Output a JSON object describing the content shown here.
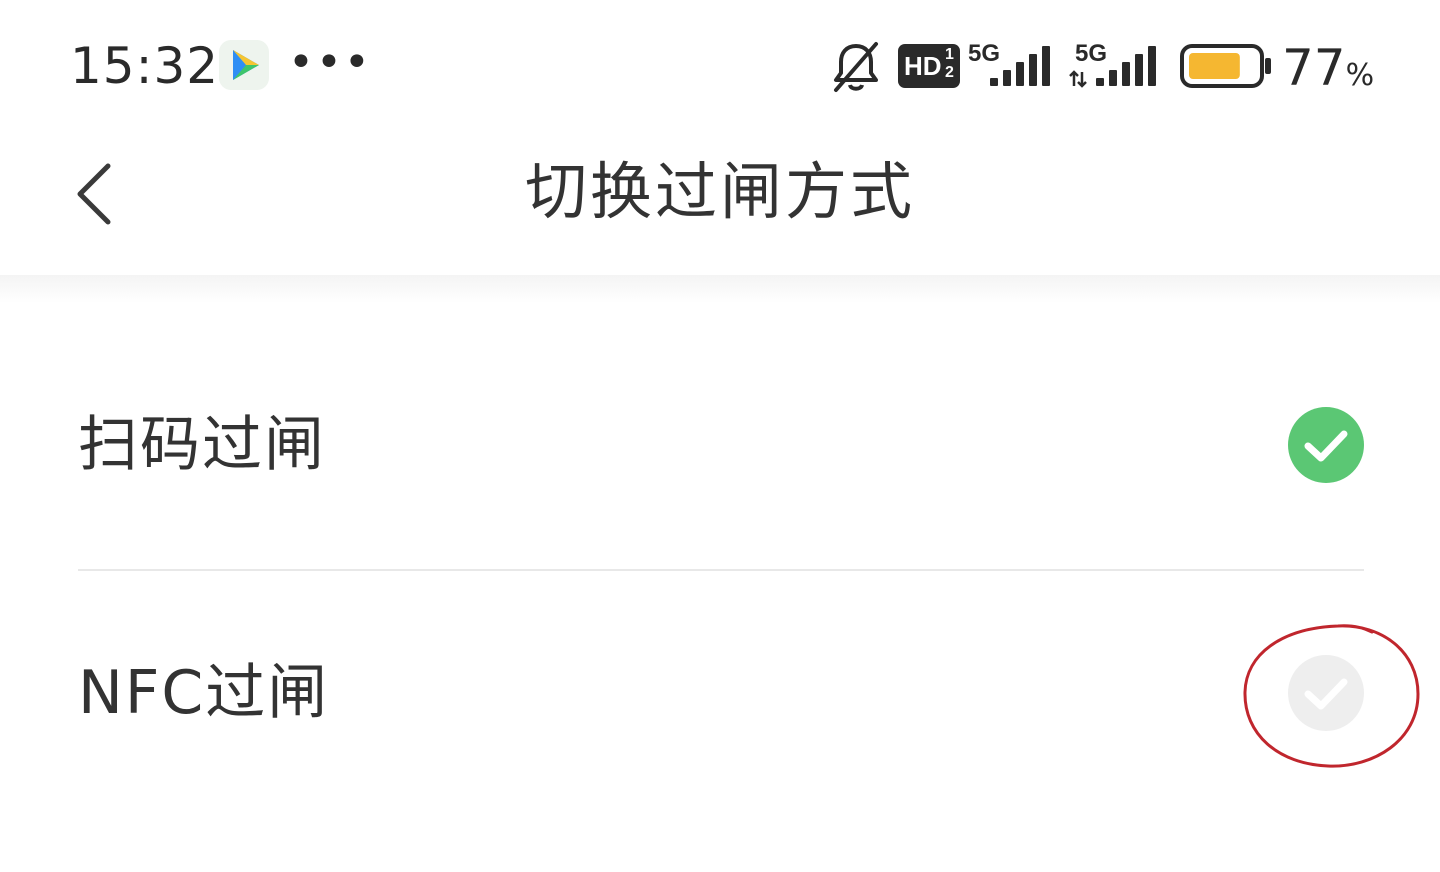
{
  "status_bar": {
    "time": "15:32",
    "more": "•••",
    "hd_label": "HD",
    "hd_sub": "1\n2",
    "sim1_label": "5G",
    "sim2_label": "5G",
    "battery_percent": "77",
    "battery_unit": "%",
    "battery_level": 0.77,
    "icons": [
      "video-app-icon",
      "more-dots-icon",
      "mute-bell-icon",
      "hd-icon",
      "signal-icon",
      "signal-icon",
      "battery-icon"
    ]
  },
  "header": {
    "title": "切换过闸方式",
    "back_icon": "chevron-left-icon"
  },
  "options": [
    {
      "label": "扫码过闸",
      "selected": true
    },
    {
      "label": "NFC过闸",
      "selected": false
    }
  ],
  "colors": {
    "selected": "#5bc774",
    "unselected": "#eeeeee",
    "battery_fill": "#f5b731",
    "annotation": "#c0262d"
  }
}
